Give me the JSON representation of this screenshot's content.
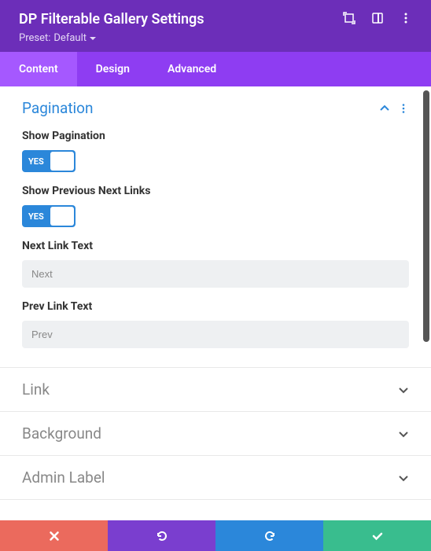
{
  "header": {
    "title": "DP Filterable Gallery Settings",
    "preset_label": "Preset:",
    "preset_value": "Default"
  },
  "tabs": {
    "content": "Content",
    "design": "Design",
    "advanced": "Advanced"
  },
  "sections": {
    "pagination": {
      "title": "Pagination"
    },
    "link": {
      "title": "Link"
    },
    "background": {
      "title": "Background"
    },
    "admin_label": {
      "title": "Admin Label"
    }
  },
  "fields": {
    "show_pagination": {
      "label": "Show Pagination",
      "state": "YES"
    },
    "show_prev_next": {
      "label": "Show Previous Next Links",
      "state": "YES"
    },
    "next_link": {
      "label": "Next Link Text",
      "placeholder": "Next"
    },
    "prev_link": {
      "label": "Prev Link Text",
      "placeholder": "Prev"
    }
  }
}
